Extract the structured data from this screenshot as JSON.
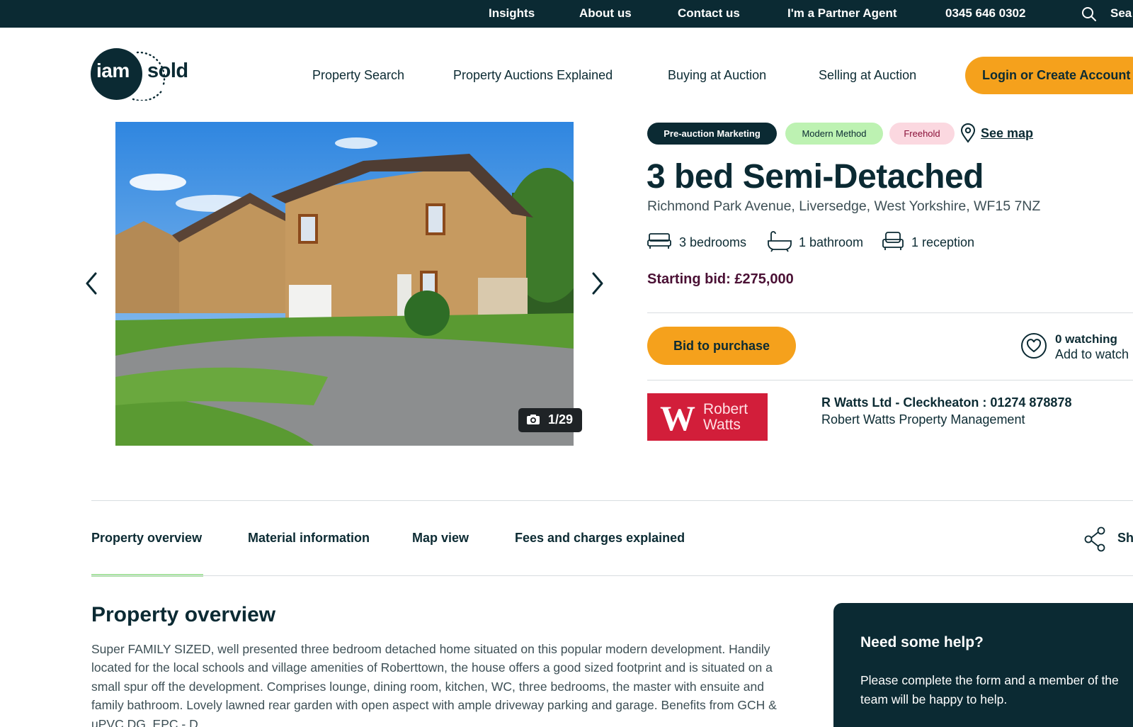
{
  "topbar": {
    "links": [
      "Insights",
      "About us",
      "Contact us",
      "I'm a Partner Agent"
    ],
    "phone": "0345 646 0302",
    "search_label": "Sea"
  },
  "header": {
    "logo": {
      "part1": "iam",
      "part2": "sold"
    },
    "nav": [
      "Property Search",
      "Property Auctions Explained",
      "Buying at Auction",
      "Selling at Auction"
    ],
    "login_label": "Login or Create Account"
  },
  "gallery": {
    "counter": "1/29",
    "icons": {
      "prev": "chevron-left-icon",
      "next": "chevron-right-icon",
      "camera": "camera-icon"
    }
  },
  "listing": {
    "tags": [
      "Pre-auction Marketing",
      "Modern Method",
      "Freehold"
    ],
    "see_map": "See map",
    "title": "3 bed Semi-Detached",
    "address": "Richmond Park Avenue, Liversedge, West Yorkshire, WF15 7NZ",
    "features": {
      "bedrooms": "3 bedrooms",
      "bathrooms": "1 bathroom",
      "receptions": "1 reception"
    },
    "starting_bid": "Starting bid: £275,000",
    "bid_button": "Bid to purchase",
    "watching": "0 watching",
    "add_watch": "Add to watch"
  },
  "agent": {
    "logo": {
      "mark": "W",
      "line1": "Robert",
      "line2": "Watts"
    },
    "branch": "R Watts Ltd - Cleckheaton : 01274 878878",
    "company": "Robert Watts Property Management"
  },
  "tabs": {
    "items": [
      "Property overview",
      "Material information",
      "Map view",
      "Fees and charges explained"
    ],
    "active": "Property overview",
    "share": "Sh"
  },
  "overview": {
    "heading": "Property overview",
    "text": "Super FAMILY SIZED, well presented three bedroom detached home situated on this popular modern development. Handily located for the local schools and village amenities of Roberttown, the house offers a good sized footprint and is situated on a small spur off the development. Comprises lounge, dining room, kitchen, WC, three bedrooms, the master with ensuite and family bathroom. Lovely lawned rear garden with open aspect with ample driveway parking and garage. Benefits from GCH & uPVC DG. EPC - D"
  },
  "help": {
    "title": "Need some help?",
    "text": "Please complete the form and a member of the team will be happy to help."
  },
  "colors": {
    "navy": "#0b2a33",
    "orange": "#f5a11c",
    "green_tag": "#bdf2b2",
    "pink_tag": "#fbd8e0",
    "bid_text": "#4a1034",
    "agent_red": "#d21e3a"
  }
}
